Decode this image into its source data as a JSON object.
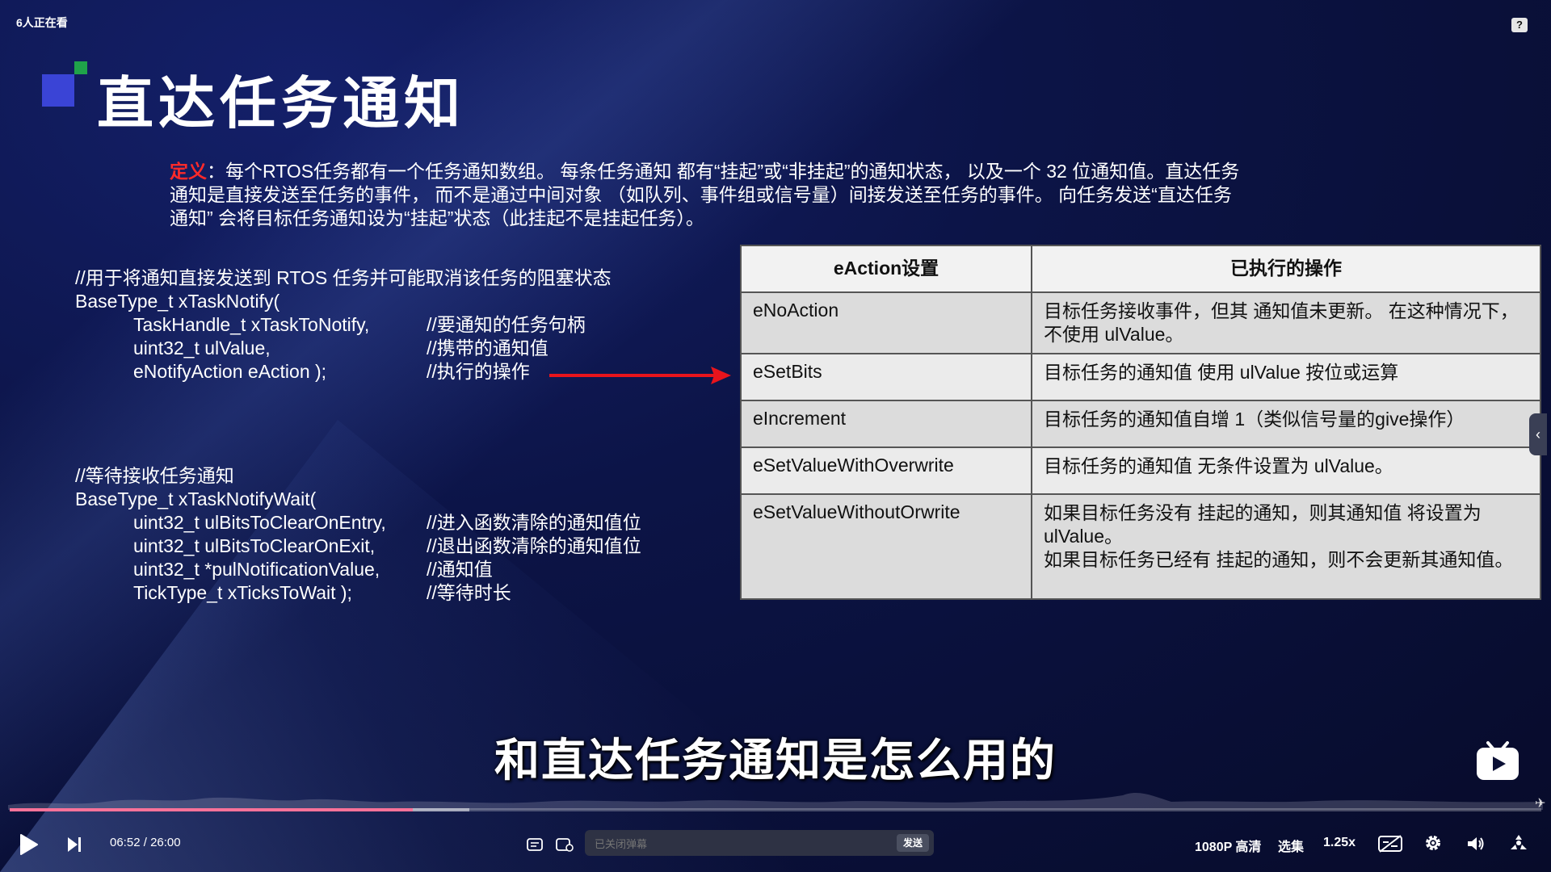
{
  "player": {
    "viewers": "6人正在看",
    "help_glyph": "?",
    "side_tab_glyph": "‹",
    "current_time": "06:52",
    "time_separator": "/",
    "duration": "26:00",
    "progress_fraction": 0.263,
    "buffered_fraction": 0.3,
    "danmaku_placeholder": "已关闭弹幕",
    "danmaku_send": "发送",
    "quality": "1080P 高清",
    "episodes": "选集",
    "speed": "1.25x",
    "subtitle_caption": "和直达任务通知是怎么用的",
    "accent_color": "#fb7299",
    "icons": [
      "play-icon",
      "next-icon",
      "danmaku-toggle-icon",
      "danmaku-settings-icon",
      "subtitle-off-icon",
      "gear-icon",
      "volume-icon",
      "fullscreen-icon",
      "bilibili-tv-icon"
    ]
  },
  "slide": {
    "title": "直达任务通知",
    "definition_label": "定义",
    "definition_text": "：每个RTOS任务都有一个任务通知数组。 每条任务通知 都有“挂起”或“非挂起”的通知状态， 以及一个 32 位通知值。直达任务通知是直接发送至任务的事件， 而不是通过中间对象 （如队列、事件组或信号量）间接发送至任务的事件。 向任务发送“直达任务通知” 会将目标任务通知设为“挂起”状态（此挂起不是挂起任务）。",
    "code1": [
      {
        "main": "//用于将通知直接发送到 RTOS 任务并可能取消该任务的阻塞状态",
        "comment": "",
        "indent": false
      },
      {
        "main": "BaseType_t xTaskNotify(",
        "comment": "",
        "indent": false
      },
      {
        "main": "TaskHandle_t xTaskToNotify,",
        "comment": "//要通知的任务句柄",
        "indent": true
      },
      {
        "main": "uint32_t ulValue,",
        "comment": "//携带的通知值",
        "indent": true
      },
      {
        "main": "eNotifyAction eAction );",
        "comment": "//执行的操作",
        "indent": true
      }
    ],
    "code2": [
      {
        "main": "//等待接收任务通知",
        "comment": "",
        "indent": false
      },
      {
        "main": "BaseType_t xTaskNotifyWait(",
        "comment": "",
        "indent": false
      },
      {
        "main": "uint32_t ulBitsToClearOnEntry,",
        "comment": "//进入函数清除的通知值位",
        "indent": true
      },
      {
        "main": "uint32_t ulBitsToClearOnExit,",
        "comment": "//退出函数清除的通知值位",
        "indent": true
      },
      {
        "main": "uint32_t *pulNotificationValue,",
        "comment": "//通知值",
        "indent": true
      },
      {
        "main": "TickType_t xTicksToWait );",
        "comment": "//等待时长",
        "indent": true
      }
    ],
    "table": {
      "headers": [
        "eAction设置",
        "已执行的操作"
      ],
      "rows": [
        {
          "action": "eNoAction",
          "desc": "目标任务接收事件，但其 通知值未更新。 在这种情况下，不使用 ulValue。"
        },
        {
          "action": "eSetBits",
          "desc": "目标任务的通知值 使用 ulValue 按位或运算"
        },
        {
          "action": "eIncrement",
          "desc": "目标任务的通知值自增 1（类似信号量的give操作）"
        },
        {
          "action": "eSetValueWithOverwrite",
          "desc": "目标任务的通知值 无条件设置为 ulValue。"
        },
        {
          "action": "eSetValueWithoutOrwrite",
          "desc": "如果目标任务没有 挂起的通知，则其通知值 将设置为 ulValue。\n如果目标任务已经有 挂起的通知，则不会更新其通知值。"
        }
      ]
    }
  }
}
